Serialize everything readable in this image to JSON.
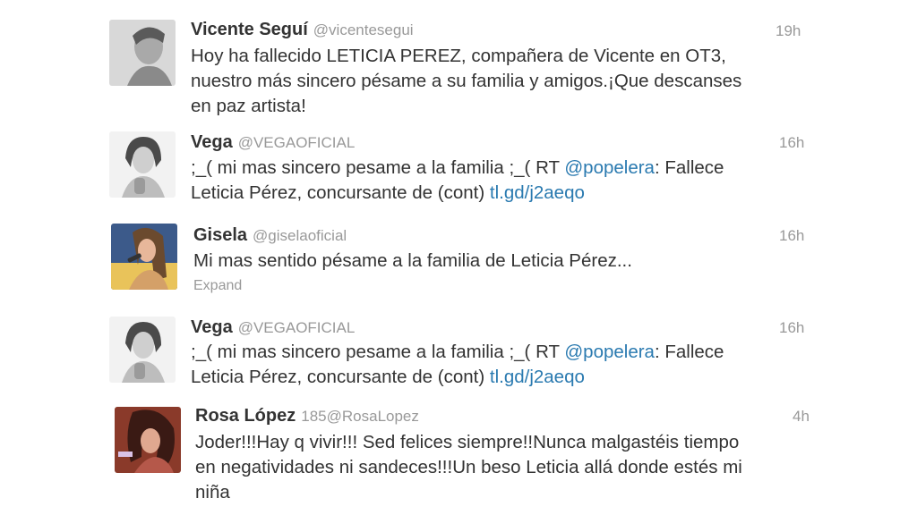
{
  "tweets": [
    {
      "name": "Vicente Seguí",
      "handle": "@vicentesegui",
      "time": "19h",
      "lines": [
        "Hoy ha fallecido LETICIA PEREZ, compañera de Vicente en OT3,",
        "nuestro más sincero pésame a su familia y amigos.¡Que descanses",
        "en paz artista!"
      ]
    },
    {
      "name": "Vega",
      "handle": "@VEGAOFICIAL",
      "time": "16h",
      "line1_text": ";_( mi mas sincero pesame a la familia ;_( RT ",
      "line1_mention": "@popelera",
      "line1_rest": ": Fallece",
      "line2_text": "Leticia Pérez, concursante de (cont) ",
      "line2_link": "tl.gd/j2aeqo"
    },
    {
      "name": "Gisela",
      "handle": "@giselaoficial",
      "time": "16h",
      "text": "Mi mas sentido pésame a la familia de Leticia Pérez...",
      "expand": "Expand"
    },
    {
      "name": "Vega",
      "handle": "@VEGAOFICIAL",
      "time": "16h",
      "line1_text": ";_( mi mas sincero pesame a la familia ;_( RT ",
      "line1_mention": "@popelera",
      "line1_rest": ": Fallece",
      "line2_text": "Leticia Pérez, concursante de (cont) ",
      "line2_link": "tl.gd/j2aeqo"
    },
    {
      "name": "Rosa López",
      "handle_prefix": "185",
      "handle": "@RosaLopez",
      "time": "4h",
      "lines": [
        "Joder!!!Hay q vivir!!! Sed felices siempre!!Nunca malgastéis tiempo",
        "en negatividades ni sandeces!!!Un beso Leticia allá donde estés mi",
        "niña"
      ]
    }
  ]
}
